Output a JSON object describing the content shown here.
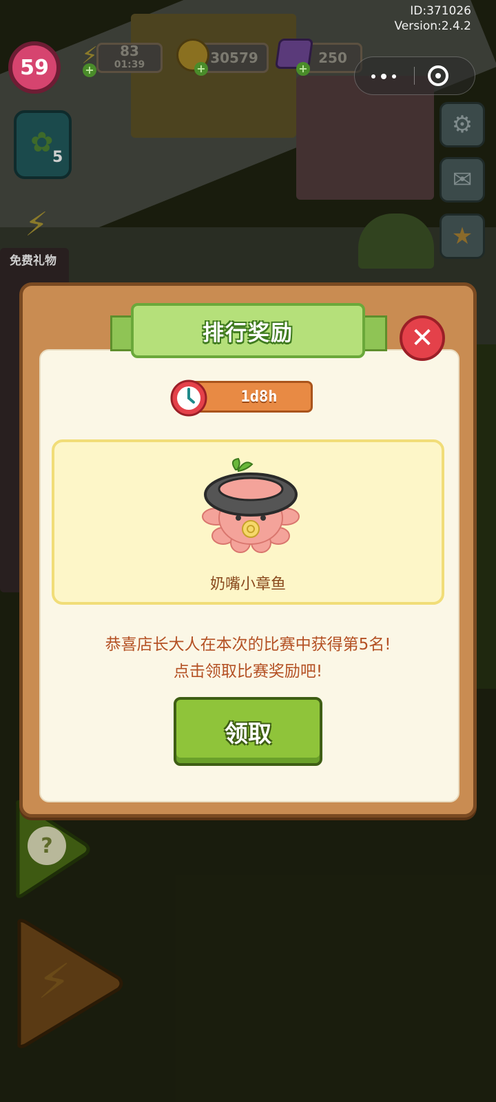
{
  "meta": {
    "id": "ID:371026",
    "version": "Version:2.4.2"
  },
  "hud": {
    "level": "59",
    "energy": {
      "value": "83",
      "timer": "01:39"
    },
    "coins": "30579",
    "gems": "250",
    "plus_symbol": "+"
  },
  "sidebar_left": {
    "star_card_count": "5",
    "free_gift_label": "免费礼物"
  },
  "modal": {
    "title": "排行奖励",
    "close_symbol": "✕",
    "timer": "1d8h",
    "reward_item_name": "奶嘴小章鱼",
    "message_line1": "恭喜店长大人在本次的比赛中获得第5名!",
    "message_line2": "点击领取比赛奖励吧!",
    "claim_label": "领取"
  },
  "bottom_left": {
    "help_symbol": "?"
  },
  "icons": [
    "gear-icon",
    "mail-icon",
    "star-badge-icon",
    "clock-icon",
    "lightning-icon",
    "coin-icon",
    "gem-icon",
    "octopus-reward-icon",
    "help-icon",
    "close-icon",
    "menu-dots-icon",
    "target-icon"
  ],
  "colors": {
    "accent_green": "#8fc43a",
    "modal_frame": "#c98c52",
    "close_red": "#e4414a",
    "timer_orange": "#e88a44",
    "text_brown": "#b45124"
  }
}
